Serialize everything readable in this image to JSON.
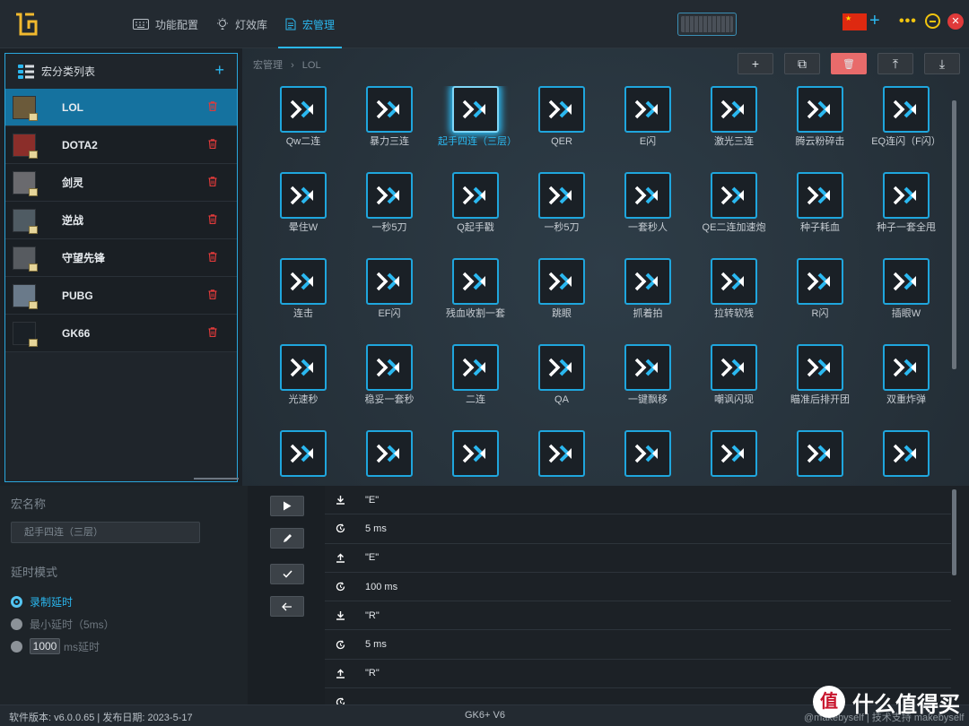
{
  "nav": {
    "items": [
      {
        "label": "功能配置",
        "icon": "keyboard-icon"
      },
      {
        "label": "灯效库",
        "icon": "bulb-icon"
      },
      {
        "label": "宏管理",
        "icon": "document-icon"
      }
    ],
    "active_index": 2
  },
  "colors": {
    "accent": "#2bb8f0",
    "danger": "#e86b6b",
    "close": "#e03a3a",
    "minimize": "#f1c40f",
    "selected_row": "#15729f"
  },
  "sidebar": {
    "title": "宏分类列表",
    "items": [
      {
        "label": "LOL",
        "thumb": "#6b5a3a"
      },
      {
        "label": "DOTA2",
        "thumb": "#8b2e2a"
      },
      {
        "label": "剑灵",
        "thumb": "#6a6a6e"
      },
      {
        "label": "逆战",
        "thumb": "#4f5b63"
      },
      {
        "label": "守望先锋",
        "thumb": "#575b60"
      },
      {
        "label": "PUBG",
        "thumb": "#6a7a8a"
      },
      {
        "label": "GK66",
        "thumb": "#1a2026"
      }
    ],
    "active_index": 0
  },
  "breadcrumb": {
    "root": "宏管理",
    "separator": "›",
    "current": "LOL"
  },
  "toolbar": [
    {
      "name": "add-macro-button",
      "glyph": "+"
    },
    {
      "name": "copy-macro-button",
      "glyph": "⧉"
    },
    {
      "name": "delete-macro-button",
      "glyph": "🗑",
      "danger": true
    },
    {
      "name": "export-macro-button",
      "glyph": "⤒"
    },
    {
      "name": "import-macro-button",
      "glyph": "⤓"
    }
  ],
  "macros": [
    "Qw二连",
    "暴力三连",
    "起手四连（三层）",
    "QER",
    "E闪",
    "激光三连",
    "腾云粉碎击",
    "EQ连闪（F闪）",
    "晕住W",
    "一秒5刀",
    "Q起手戳",
    "一秒5刀",
    "一套秒人",
    "QE二连加速炮",
    "种子耗血",
    "种子一套全甩",
    "连击",
    "EF闪",
    "残血收割一套",
    "跳眼",
    "抓着拍",
    "拉转软残",
    "R闪",
    "插眼W",
    "光速秒",
    "稳妥一套秒",
    "二连",
    "QA",
    "一键飘移",
    "嘲讽闪现",
    "瞄准后排开团",
    "双重炸弹",
    "",
    "",
    "",
    "",
    "",
    "",
    "",
    ""
  ],
  "selected_macro_index": 2,
  "editor": {
    "name_label": "宏名称",
    "name_value": "起手四连（三层）",
    "delay_mode_label": "延时模式",
    "options": {
      "record": "录制延时",
      "min": "最小延时（5ms）",
      "custom_value": "1000",
      "custom_suffix": "ms延时"
    },
    "selected_option": "record"
  },
  "steps": [
    {
      "icon": "key-down-icon",
      "text": "\"E\""
    },
    {
      "icon": "delay-icon",
      "text": "5 ms"
    },
    {
      "icon": "key-up-icon",
      "text": "\"E\""
    },
    {
      "icon": "delay-icon",
      "text": "100 ms"
    },
    {
      "icon": "key-down-icon",
      "text": "\"R\""
    },
    {
      "icon": "delay-icon",
      "text": "5 ms"
    },
    {
      "icon": "key-up-icon",
      "text": "\"R\""
    },
    {
      "icon": "delay-icon",
      "text": ""
    }
  ],
  "status": {
    "version": "软件版本: v6.0.0.65 | 发布日期: 2023-5-17",
    "model": "GK6+ V6",
    "credit": "@makebyself | 技术支持 makebyself"
  },
  "watermark": {
    "circle": "值",
    "text": "什么值得买"
  }
}
